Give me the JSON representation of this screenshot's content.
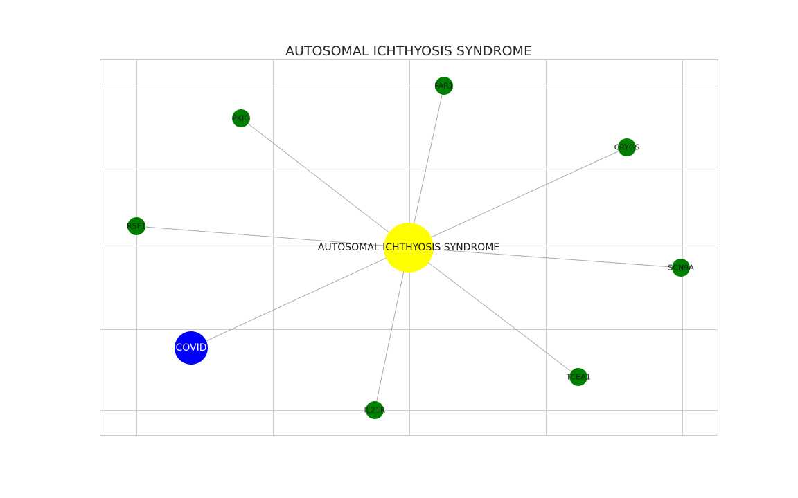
{
  "title": "AUTOSOMAL ICHTHYOSIS SYNDROME",
  "colors": {
    "center": "#ffff00",
    "gene": "#008000",
    "covid": "#0000ff",
    "edge": "#aaaaaa",
    "grid": "#cccccc"
  },
  "nodes": [
    {
      "id": "center",
      "label": "AUTOSOMAL ICHTHYOSIS SYNDROME",
      "kind": "center"
    },
    {
      "id": "far1",
      "label": "FAR1",
      "kind": "gene"
    },
    {
      "id": "pkig",
      "label": "PKIG",
      "kind": "gene"
    },
    {
      "id": "crygs",
      "label": "CRYGS",
      "kind": "gene"
    },
    {
      "id": "rsf1",
      "label": "RSF1",
      "kind": "gene"
    },
    {
      "id": "scn9a",
      "label": "SCN9A",
      "kind": "gene"
    },
    {
      "id": "covid",
      "label": "COVID",
      "kind": "covid"
    },
    {
      "id": "tcea1",
      "label": "TCEA1",
      "kind": "gene"
    },
    {
      "id": "il21r",
      "label": "IL21R",
      "kind": "gene"
    }
  ],
  "edges": [
    [
      "center",
      "far1"
    ],
    [
      "center",
      "pkig"
    ],
    [
      "center",
      "crygs"
    ],
    [
      "center",
      "rsf1"
    ],
    [
      "center",
      "scn9a"
    ],
    [
      "center",
      "covid"
    ],
    [
      "center",
      "tcea1"
    ],
    [
      "center",
      "il21r"
    ]
  ]
}
